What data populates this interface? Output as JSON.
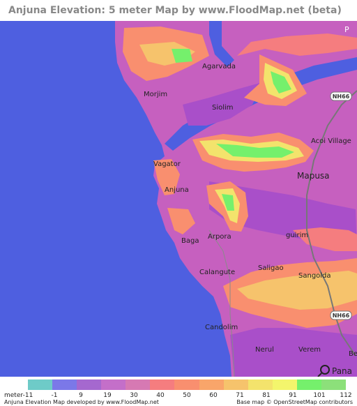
{
  "title": "Anjuna Elevation: 5 meter Map by www.FloodMap.net (beta)",
  "map": {
    "places": [
      {
        "id": "agarvada",
        "label": "Agarvada"
      },
      {
        "id": "morjim",
        "label": "Morjim"
      },
      {
        "id": "siolim",
        "label": "Siolim"
      },
      {
        "id": "acoi-village",
        "label": "Acoi Village"
      },
      {
        "id": "vagator",
        "label": "Vagator"
      },
      {
        "id": "mapusa",
        "label": "Mapusa"
      },
      {
        "id": "anjuna",
        "label": "Anjuna"
      },
      {
        "id": "baga",
        "label": "Baga"
      },
      {
        "id": "arpora",
        "label": "Arpora"
      },
      {
        "id": "guirim",
        "label": "guirim"
      },
      {
        "id": "calangute",
        "label": "Calangute"
      },
      {
        "id": "saligao",
        "label": "Saligao"
      },
      {
        "id": "sangolda",
        "label": "Sangolda"
      },
      {
        "id": "candolim",
        "label": "Candolim"
      },
      {
        "id": "nerul",
        "label": "Nerul"
      },
      {
        "id": "verem",
        "label": "Verem"
      }
    ],
    "roads": [
      {
        "id": "nh66-north",
        "label": "NH66"
      },
      {
        "id": "nh66-south",
        "label": "NH66"
      }
    ],
    "corner_label_top": "P",
    "corner_label_bottom": "Pana",
    "corner_label_edge": "Be",
    "colors": {
      "sea": "#4e5fe0",
      "lowland": "#a94fc9",
      "land": "#c660bf"
    }
  },
  "legend": {
    "unit": "meter",
    "ticks": [
      "-11",
      "-1",
      "9",
      "19",
      "30",
      "40",
      "50",
      "60",
      "71",
      "81",
      "91",
      "101",
      "112"
    ],
    "colors": [
      "#6ecbc8",
      "#7b78e8",
      "#a568cf",
      "#c46fc9",
      "#d679b3",
      "#f57d7f",
      "#f98f6f",
      "#f9a56a",
      "#f6c36c",
      "#f3e36c",
      "#f3f56c",
      "#75f06c",
      "#8ce07a"
    ]
  },
  "footer": {
    "left": "Anjuna Elevation Map developed by www.FloodMap.net",
    "right": "Base map © OpenStreetMap contributors"
  }
}
